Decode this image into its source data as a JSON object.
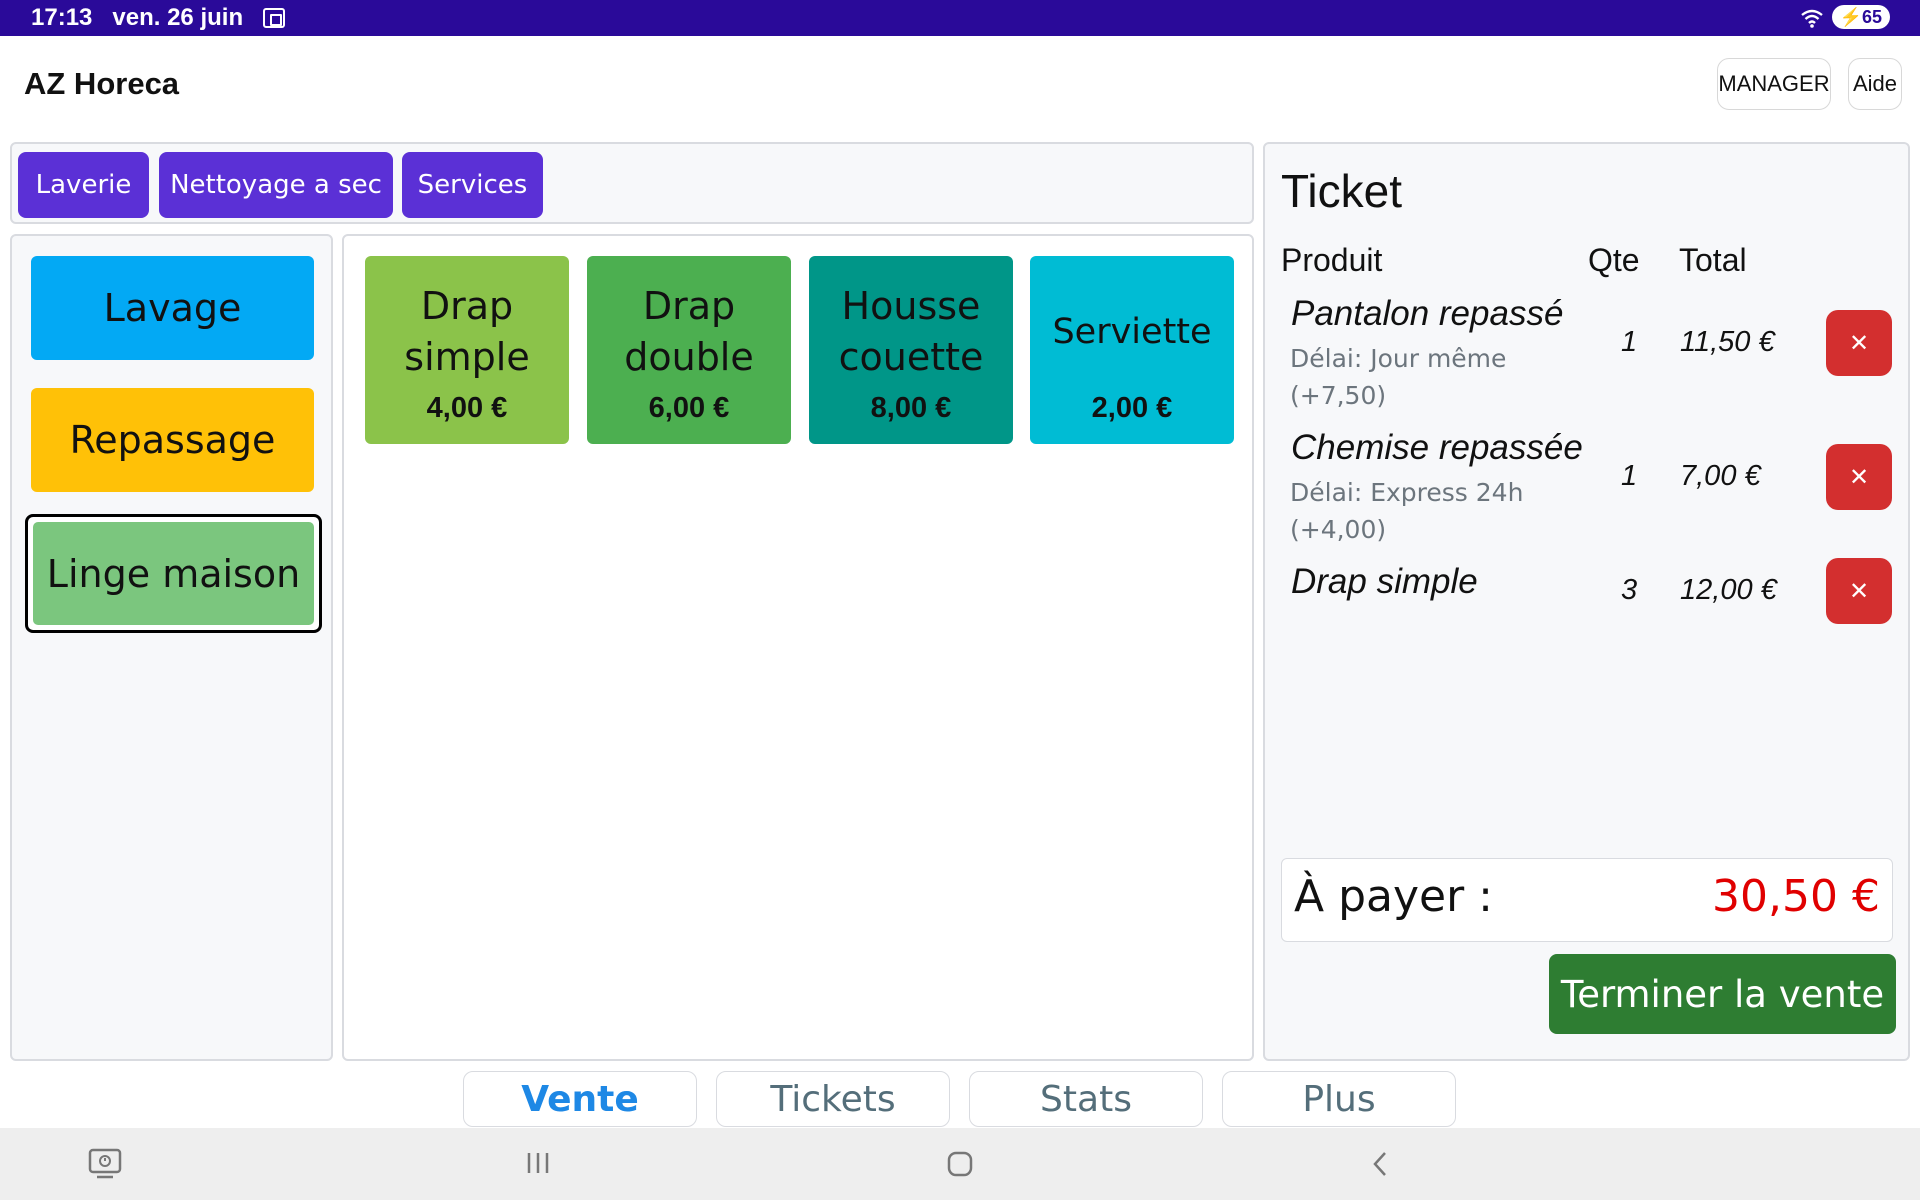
{
  "status_bar": {
    "time": "17:13",
    "date": "ven. 26 juin",
    "battery": "65",
    "icons": [
      "screenshot-icon",
      "wifi-icon",
      "battery-icon"
    ]
  },
  "header": {
    "title": "AZ Horeca",
    "manager_label": "MANAGER",
    "help_label": "Aide"
  },
  "categories": [
    {
      "label": "Laverie"
    },
    {
      "label": "Nettoyage a sec"
    },
    {
      "label": "Services"
    }
  ],
  "subcategories": [
    {
      "label": "Lavage",
      "color": "#03a9f4"
    },
    {
      "label": "Repassage",
      "color": "#ffc107"
    },
    {
      "label": "Linge maison",
      "color": "#7bc67e",
      "selected": true
    }
  ],
  "products": [
    {
      "name": "Drap simple",
      "price": "4,00 €",
      "color": "#8bc34a"
    },
    {
      "name": "Drap double",
      "price": "6,00 €",
      "color": "#4caf50"
    },
    {
      "name": "Housse couette",
      "price": "8,00 €",
      "color": "#009688"
    },
    {
      "name": "Serviette",
      "price": "2,00 €",
      "color": "#00bcd4"
    }
  ],
  "ticket": {
    "title": "Ticket",
    "col_product": "Produit",
    "col_qty": "Qte",
    "col_total": "Total",
    "items": [
      {
        "name": "Pantalon repassé",
        "detail": "Délai: Jour même (+7,50)",
        "qty": "1",
        "total": "11,50 €"
      },
      {
        "name": "Chemise repassée",
        "detail": "Délai: Express 24h (+4,00)",
        "qty": "1",
        "total": "7,00 €"
      },
      {
        "name": "Drap simple",
        "detail": "",
        "qty": "3",
        "total": "12,00 €"
      }
    ],
    "delete_symbol": "✕",
    "pay_label": "À payer :",
    "pay_amount": "30,50 €",
    "finish_label": "Terminer la vente"
  },
  "nav_tabs": [
    {
      "label": "Vente",
      "active": true
    },
    {
      "label": "Tickets",
      "active": false
    },
    {
      "label": "Stats",
      "active": false
    },
    {
      "label": "Plus",
      "active": false
    }
  ],
  "colors": {
    "status_bar": "#2a0a99",
    "category_button": "#5b30d6",
    "delete_button": "#d32f2f",
    "finish_button": "#2e7d32",
    "amount_text": "#e00000",
    "active_tab": "#1e88e5"
  }
}
